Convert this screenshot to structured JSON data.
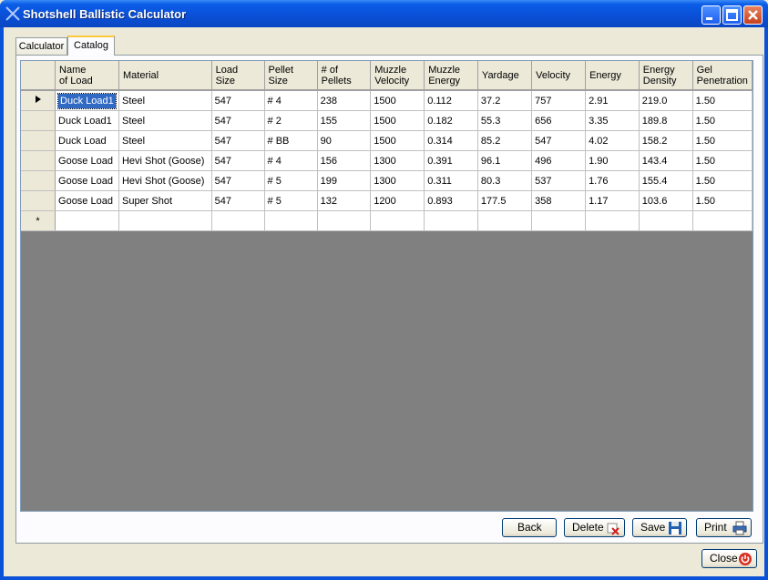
{
  "window": {
    "title": "Shotshell Ballistic Calculator"
  },
  "tabs": [
    {
      "label": "Calculator"
    },
    {
      "label": "Catalog"
    }
  ],
  "grid": {
    "columns": [
      "Name\nof Load",
      "Material",
      "Load\nSize",
      "Pellet\nSize",
      "# of\nPellets",
      "Muzzle\nVelocity",
      "Muzzle\nEnergy",
      "Yardage",
      "Velocity",
      "Energy",
      "Energy\nDensity",
      "Gel\nPenetration"
    ],
    "rows": [
      [
        "Duck Load1",
        "Steel",
        "547",
        "# 4",
        "238",
        "1500",
        "0.112",
        "37.2",
        "757",
        "2.91",
        "219.0",
        "1.50"
      ],
      [
        "Duck Load1",
        "Steel",
        "547",
        "# 2",
        "155",
        "1500",
        "0.182",
        "55.3",
        "656",
        "3.35",
        "189.8",
        "1.50"
      ],
      [
        "Duck Load",
        "Steel",
        "547",
        "# BB",
        "90",
        "1500",
        "0.314",
        "85.2",
        "547",
        "4.02",
        "158.2",
        "1.50"
      ],
      [
        "Goose  Load",
        "Hevi Shot (Goose)",
        "547",
        "# 4",
        "156",
        "1300",
        "0.391",
        "96.1",
        "496",
        "1.90",
        "143.4",
        "1.50"
      ],
      [
        "Goose  Load",
        "Hevi Shot (Goose)",
        "547",
        "# 5",
        "199",
        "1300",
        "0.311",
        "80.3",
        "537",
        "1.76",
        "155.4",
        "1.50"
      ],
      [
        "Goose  Load",
        "Super Shot",
        "547",
        "# 5",
        "132",
        "1200",
        "0.893",
        "177.5",
        "358",
        "1.17",
        "103.6",
        "1.50"
      ]
    ],
    "new_row_marker": "*"
  },
  "buttons": {
    "back": "Back",
    "delete": "Delete",
    "save": "Save",
    "print": "Print",
    "close": "Close"
  }
}
